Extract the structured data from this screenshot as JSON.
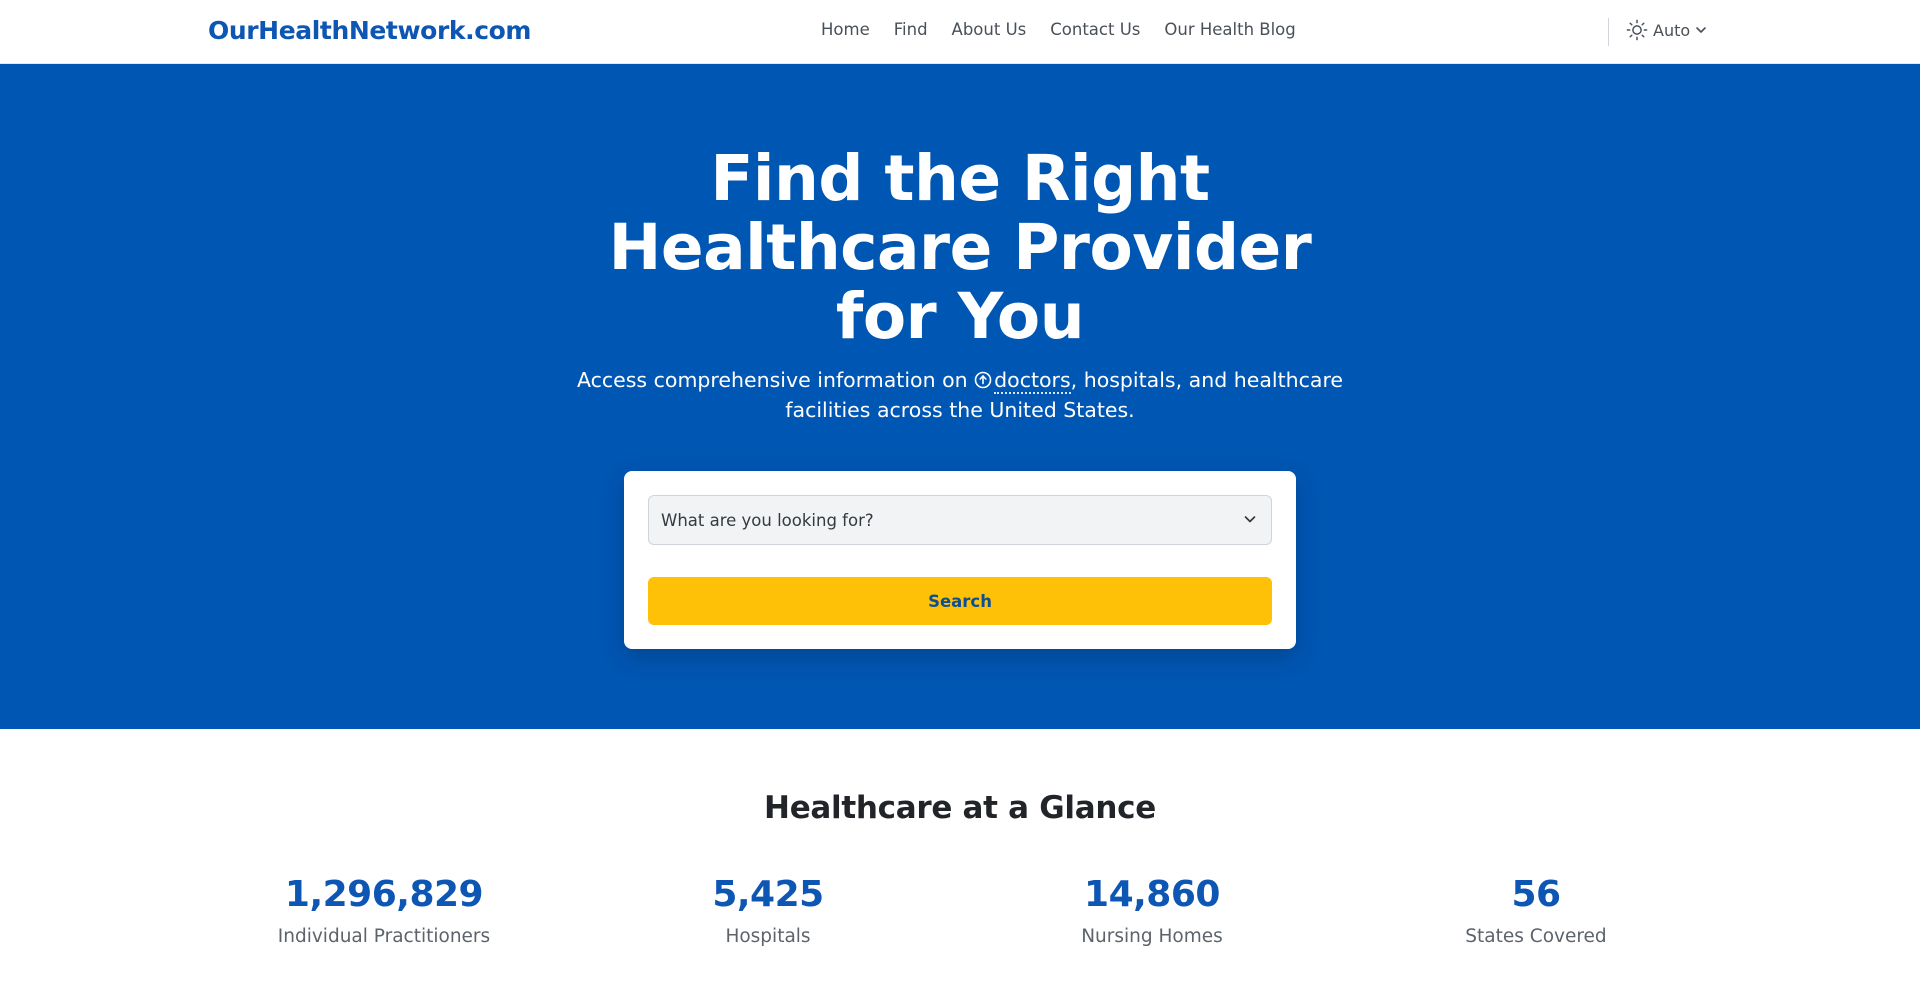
{
  "navbar": {
    "brand": "OurHealthNetwork.com",
    "links": [
      "Home",
      "Find",
      "About Us",
      "Contact Us",
      "Our Health Blog"
    ],
    "theme_label": "Auto"
  },
  "hero": {
    "title": "Find the Right Healthcare Provider for You",
    "subtitle_before": "Access comprehensive information on",
    "subtitle_term": "doctors",
    "subtitle_after": ", hospitals, and healthcare facilities across the United States.",
    "background_color": "#0056b3"
  },
  "search": {
    "select_value": "What are you looking for?",
    "button_label": "Search",
    "button_color": "#ffc107"
  },
  "glance": {
    "title": "Healthcare at a Glance",
    "stats": [
      {
        "value": "1,296,829",
        "label": "Individual Practitioners"
      },
      {
        "value": "5,425",
        "label": "Hospitals"
      },
      {
        "value": "14,860",
        "label": "Nursing Homes"
      },
      {
        "value": "56",
        "label": "States Covered"
      }
    ]
  },
  "colors": {
    "brand": "#0d56b3",
    "accent": "#ffc107"
  },
  "icons": {
    "theme": "sun-icon",
    "theme_chevron": "chevron-down-icon",
    "select_chevron": "chevron-down-icon",
    "subtitle_info": "info-circle-icon"
  }
}
